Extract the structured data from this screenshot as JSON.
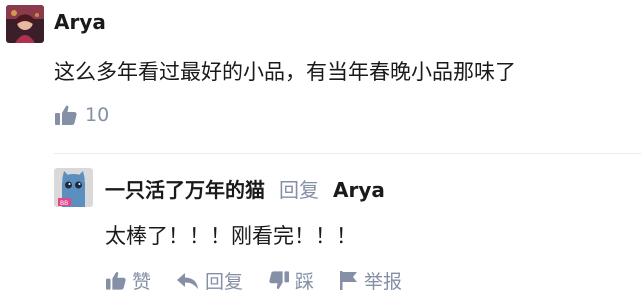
{
  "comment": {
    "username": "Arya",
    "text": "这么多年看过最好的小品，有当年春晚小品那味了",
    "likes": "10"
  },
  "reply": {
    "username": "一只活了万年的猫",
    "verb": "回复",
    "target": "Arya",
    "text": "太棒了！！！刚看完！！！",
    "actions": {
      "like": "赞",
      "reply": "回复",
      "dislike": "踩",
      "report": "举报"
    }
  },
  "icons": {
    "like": "thumbs-up-icon",
    "reply": "reply-arrow-icon",
    "dislike": "thumbs-down-icon",
    "report": "flag-icon"
  },
  "colors": {
    "text": "#1a1a1a",
    "muted": "#8590a6",
    "divider": "#ebebeb"
  }
}
